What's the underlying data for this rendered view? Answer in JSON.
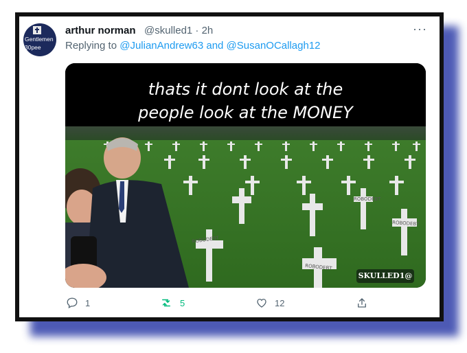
{
  "tweet": {
    "author_name": "arthur norman",
    "author_handle": "@skulled1 · 2h",
    "reply_prefix": "Replying to",
    "reply_targets": "@JulianAndrew63 and @SusanOCallagh12",
    "more_label": "···",
    "avatar": {
      "line1": "Gentlemen",
      "line2": "30pee"
    }
  },
  "media": {
    "caption_line1": "thats it dont look at the",
    "caption_line2": "people look at the MONEY",
    "watermark": "SKULLED1@",
    "grave_label": "ROBODEBT"
  },
  "actions": {
    "reply_count": "1",
    "retweet_count": "5",
    "like_count": "12",
    "colors": {
      "retweet": "#00ba7c",
      "muted": "#536471",
      "link": "#1d9bf0"
    }
  }
}
